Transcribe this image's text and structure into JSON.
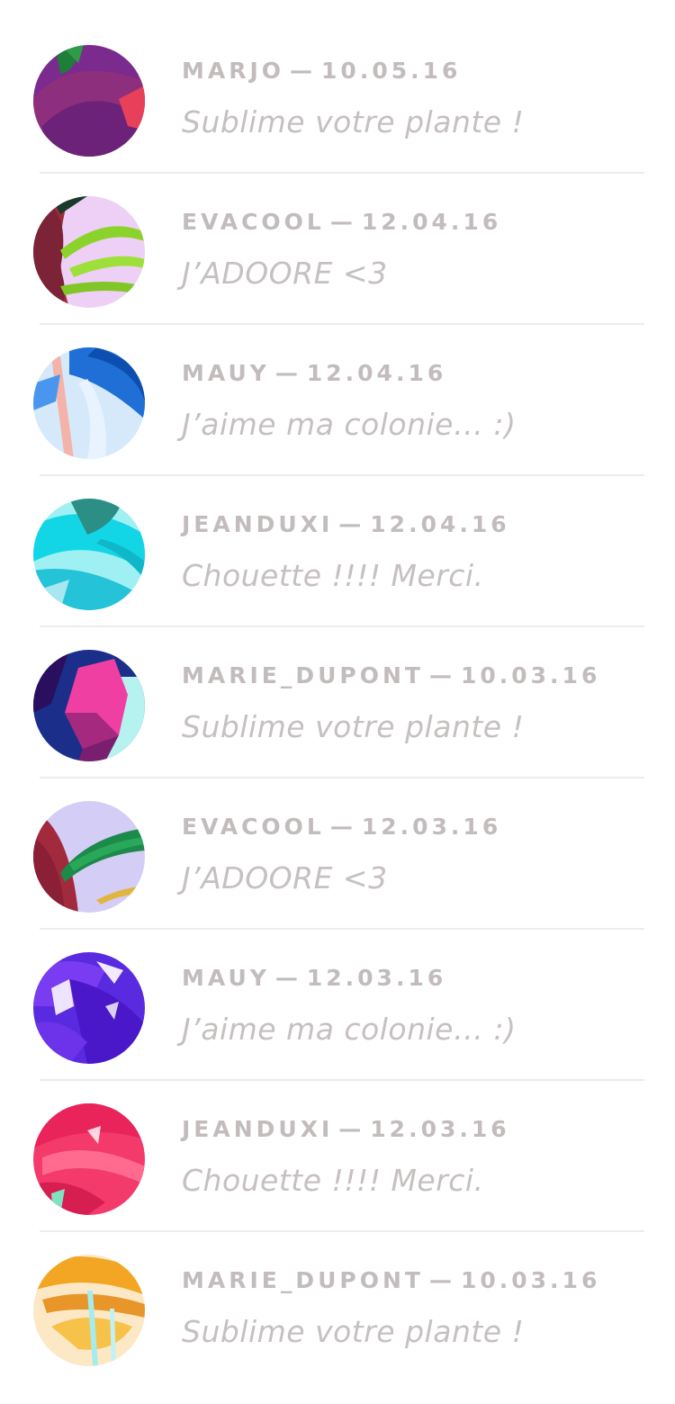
{
  "separator": "—",
  "comments": [
    {
      "username": "MARJO",
      "date": "10.05.16",
      "message": "Sublime votre plante !"
    },
    {
      "username": "EVACOOL",
      "date": "12.04.16",
      "message": "J’ADOORE <3"
    },
    {
      "username": "MAUY",
      "date": "12.04.16",
      "message": "J’aime ma colonie… :)"
    },
    {
      "username": "JEANDUXI",
      "date": "12.04.16",
      "message": "Chouette !!!! Merci."
    },
    {
      "username": "MARIE_DUPONT",
      "date": "10.03.16",
      "message": "Sublime votre plante !"
    },
    {
      "username": "EVACOOL",
      "date": "12.03.16",
      "message": "J’ADOORE <3"
    },
    {
      "username": "MAUY",
      "date": "12.03.16",
      "message": "J’aime ma colonie… :)"
    },
    {
      "username": "JEANDUXI",
      "date": "12.03.16",
      "message": "Chouette !!!! Merci."
    },
    {
      "username": "MARIE_DUPONT",
      "date": "10.03.16",
      "message": "Sublime votre plante !"
    }
  ],
  "colors": {
    "meta_text": "#c3bcbc",
    "message_text": "#c6c0c0",
    "divider": "#ececec"
  }
}
